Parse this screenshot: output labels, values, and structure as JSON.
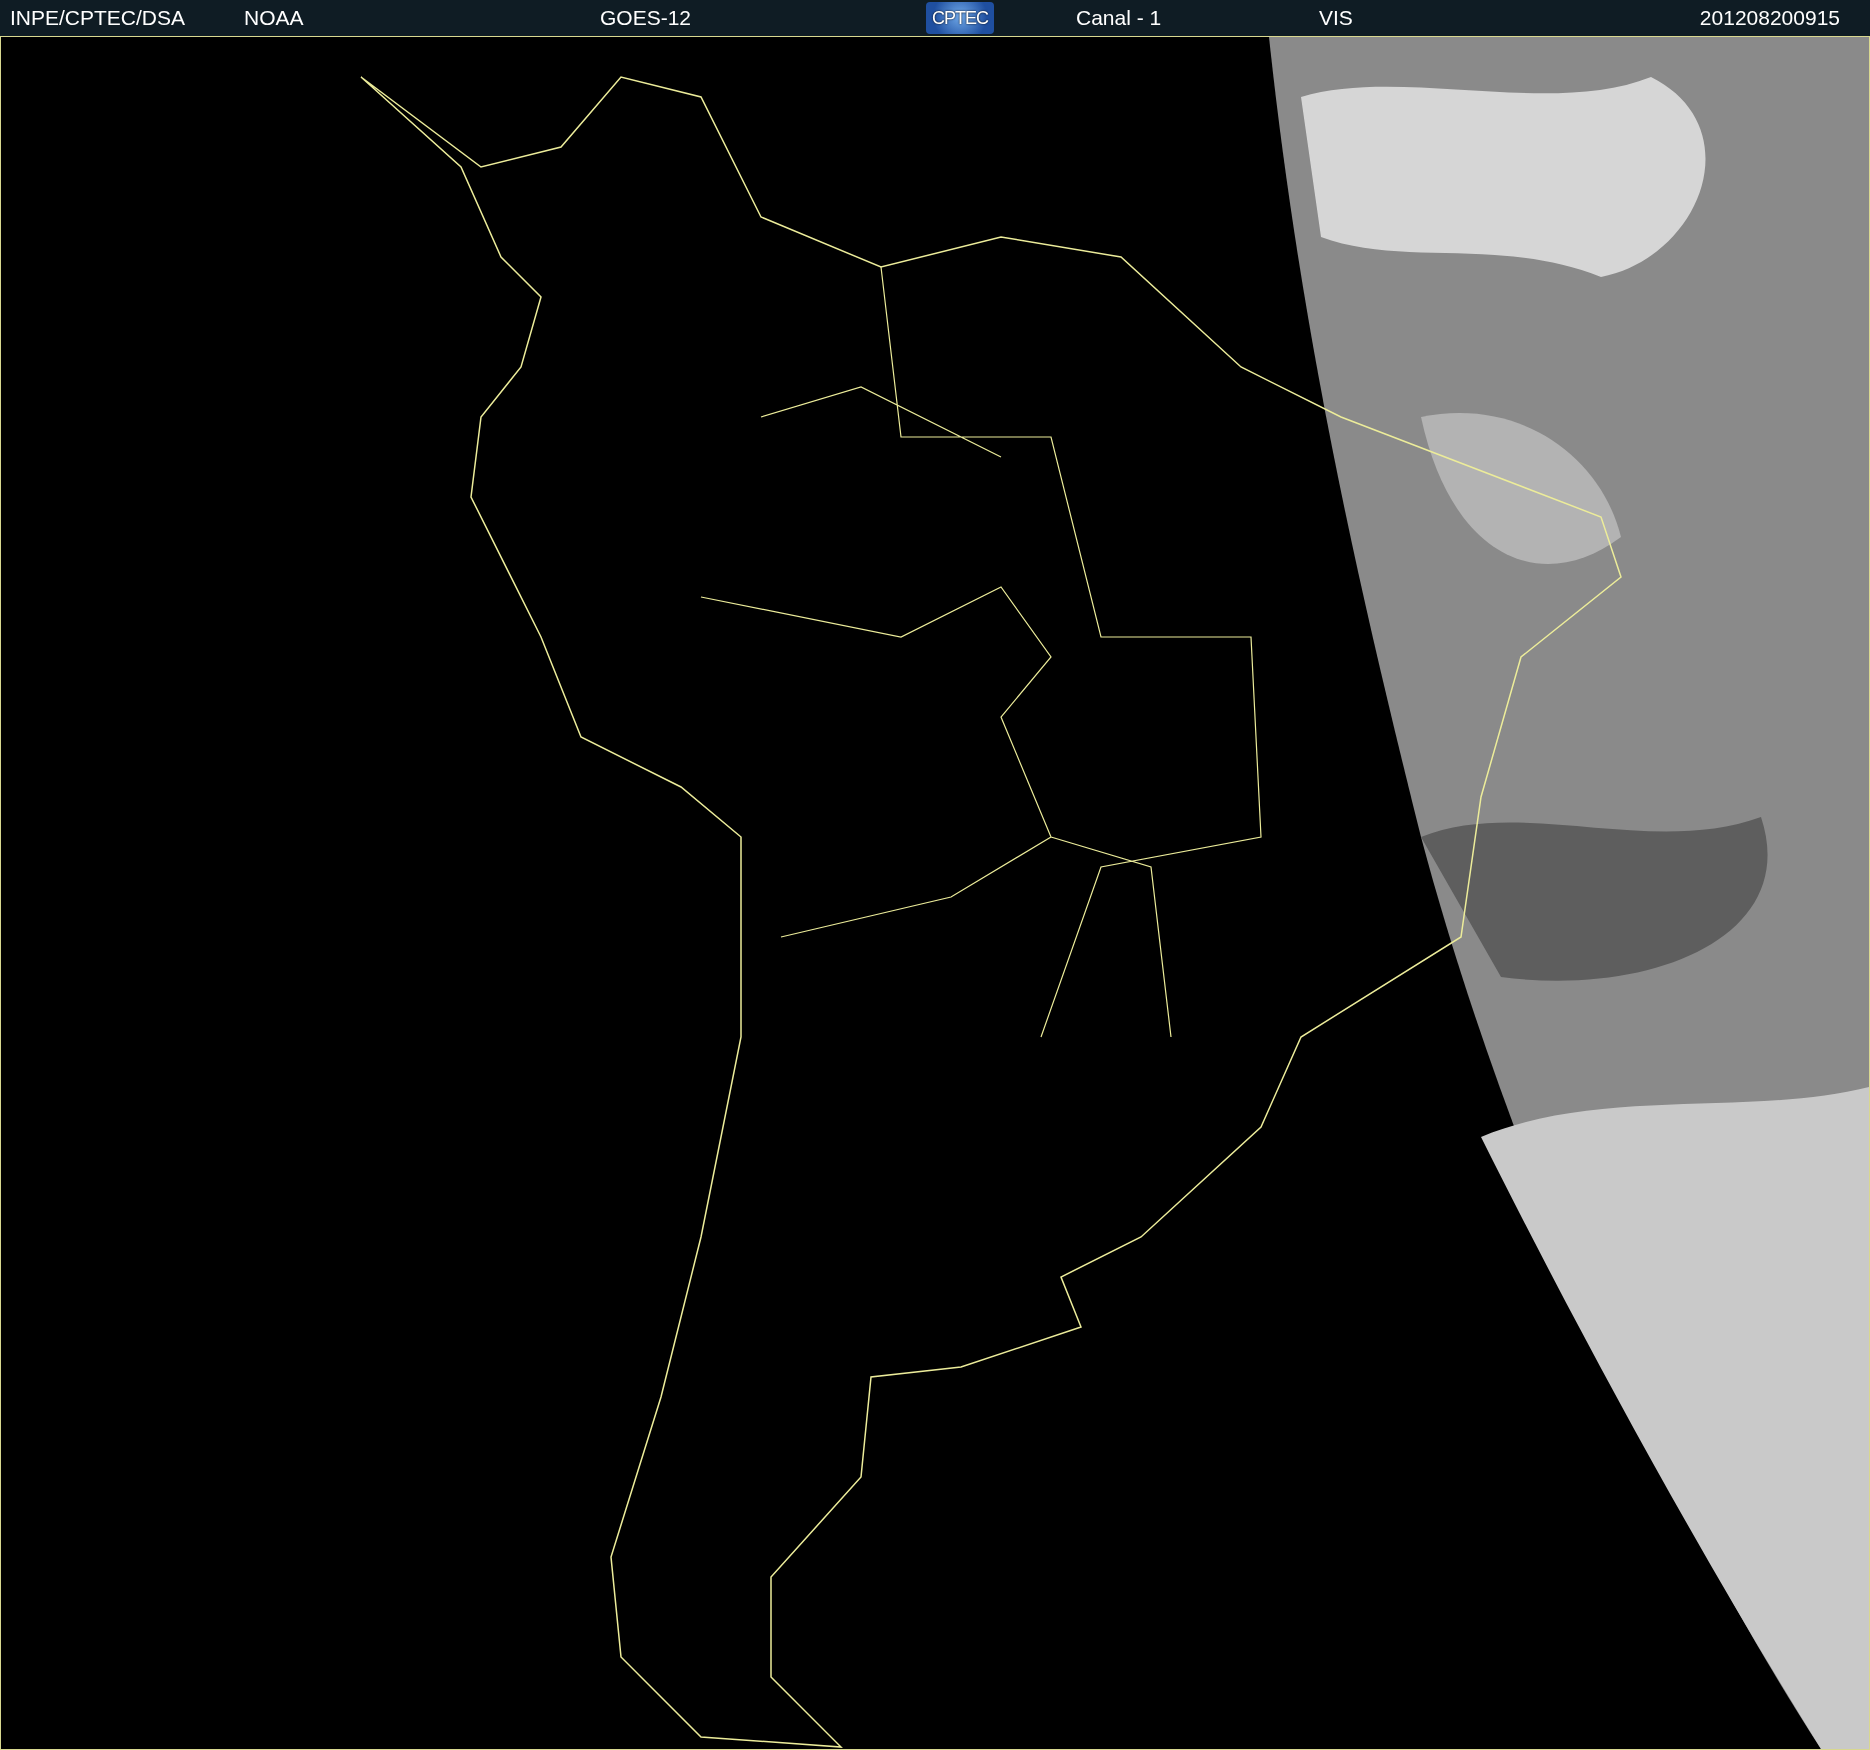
{
  "header": {
    "source": "INPE/CPTEC/DSA",
    "agency": "NOAA",
    "satellite": "GOES-12",
    "logo": "CPTEC",
    "channel": "Canal - 1",
    "band": "VIS",
    "timestamp": "201208200915"
  }
}
